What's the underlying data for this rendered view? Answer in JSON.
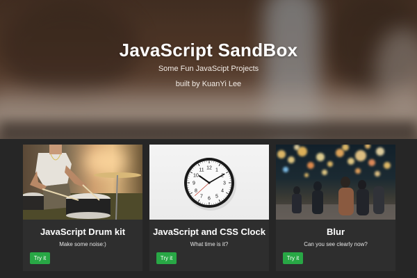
{
  "hero": {
    "title": "JavaScript SandBox",
    "subtitle": "Some Fun JavaScipt Projects",
    "author": "built by KuanYi Lee"
  },
  "cards": [
    {
      "title": "JavaScript Drum kit",
      "description": "Make some noise:)",
      "button_label": "Try it",
      "image": "drummer-photo"
    },
    {
      "title": "JavaScript and CSS Clock",
      "description": "What time is it?",
      "button_label": "Try it",
      "image": "wall-clock-photo",
      "clock": {
        "hour": 10,
        "minute": 10,
        "second": 38
      }
    },
    {
      "title": "Blur",
      "description": "Can you see clearly now?",
      "button_label": "Try it",
      "image": "bokeh-street-photo"
    }
  ],
  "colors": {
    "background": "#262626",
    "card": "#2e2e2e",
    "button": "#28a745",
    "text": "#ffffff"
  }
}
